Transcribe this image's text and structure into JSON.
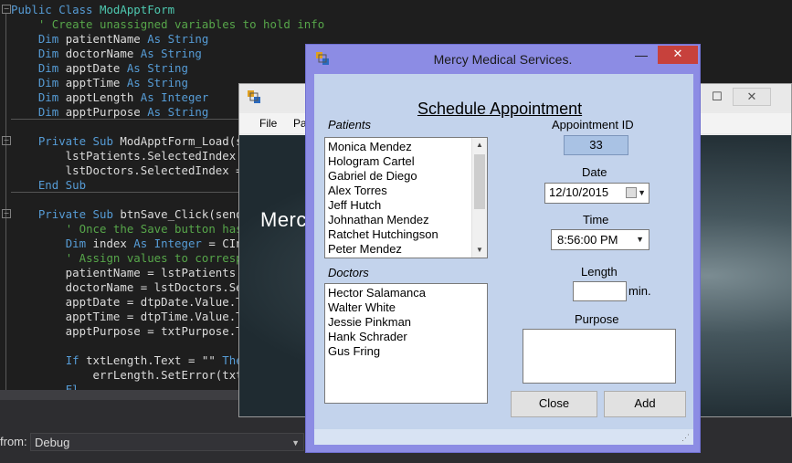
{
  "editor": {
    "lines": [
      {
        "segs": [
          [
            "kw",
            "Public Class "
          ],
          [
            "ty",
            "ModApptForm"
          ]
        ]
      },
      {
        "segs": [
          [
            "pl",
            "    "
          ],
          [
            "cm",
            "' Create unassigned variables to hold info"
          ]
        ]
      },
      {
        "segs": [
          [
            "pl",
            "    "
          ],
          [
            "kw",
            "Dim "
          ],
          [
            "pl",
            "patientName "
          ],
          [
            "kw",
            "As String"
          ]
        ]
      },
      {
        "segs": [
          [
            "pl",
            "    "
          ],
          [
            "kw",
            "Dim "
          ],
          [
            "pl",
            "doctorName "
          ],
          [
            "kw",
            "As String"
          ]
        ]
      },
      {
        "segs": [
          [
            "pl",
            "    "
          ],
          [
            "kw",
            "Dim "
          ],
          [
            "pl",
            "apptDate "
          ],
          [
            "kw",
            "As String"
          ]
        ]
      },
      {
        "segs": [
          [
            "pl",
            "    "
          ],
          [
            "kw",
            "Dim "
          ],
          [
            "pl",
            "apptTime "
          ],
          [
            "kw",
            "As String"
          ]
        ]
      },
      {
        "segs": [
          [
            "pl",
            "    "
          ],
          [
            "kw",
            "Dim "
          ],
          [
            "pl",
            "apptLength "
          ],
          [
            "kw",
            "As Integer"
          ]
        ]
      },
      {
        "segs": [
          [
            "pl",
            "    "
          ],
          [
            "kw",
            "Dim "
          ],
          [
            "pl",
            "apptPurpose "
          ],
          [
            "kw",
            "As String"
          ]
        ]
      },
      {
        "segs": []
      },
      {
        "segs": [
          [
            "pl",
            "    "
          ],
          [
            "kw",
            "Private Sub "
          ],
          [
            "pl",
            "ModApptForm_Load(sen"
          ]
        ]
      },
      {
        "segs": [
          [
            "pl",
            "        lstPatients.SelectedIndex = "
          ]
        ]
      },
      {
        "segs": [
          [
            "pl",
            "        lstDoctors.SelectedIndex = 0"
          ]
        ]
      },
      {
        "segs": [
          [
            "pl",
            "    "
          ],
          [
            "kw",
            "End Sub"
          ]
        ]
      },
      {
        "segs": []
      },
      {
        "segs": [
          [
            "pl",
            "    "
          ],
          [
            "kw",
            "Private Sub "
          ],
          [
            "pl",
            "btnSave_Click(sender"
          ]
        ]
      },
      {
        "segs": [
          [
            "pl",
            "        "
          ],
          [
            "cm",
            "' Once the Save button has b"
          ]
        ]
      },
      {
        "segs": [
          [
            "pl",
            "        "
          ],
          [
            "kw",
            "Dim "
          ],
          [
            "pl",
            "index "
          ],
          [
            "kw",
            "As Integer "
          ],
          [
            "pl",
            "= CInt"
          ]
        ]
      },
      {
        "segs": [
          [
            "pl",
            "        "
          ],
          [
            "cm",
            "' Assign values to correspon"
          ]
        ]
      },
      {
        "segs": [
          [
            "pl",
            "        patientName = lstPatients.Sel"
          ]
        ]
      },
      {
        "segs": [
          [
            "pl",
            "        doctorName = lstDoctors.Sele"
          ]
        ]
      },
      {
        "segs": [
          [
            "pl",
            "        apptDate = dtpDate.Value.ToS"
          ]
        ]
      },
      {
        "segs": [
          [
            "pl",
            "        apptTime = dtpTime.Value.ToS"
          ]
        ]
      },
      {
        "segs": [
          [
            "pl",
            "        apptPurpose = txtPurpose.Tex"
          ]
        ]
      },
      {
        "segs": []
      },
      {
        "segs": [
          [
            "pl",
            "        "
          ],
          [
            "kw",
            "If "
          ],
          [
            "pl",
            "txtLength.Text = "
          ],
          [
            "pl",
            "\"\" "
          ],
          [
            "kw",
            "Then"
          ]
        ]
      },
      {
        "segs": [
          [
            "pl",
            "            errLength.SetError(txtLe"
          ]
        ]
      },
      {
        "segs": [
          [
            "pl",
            "        "
          ],
          [
            "kw",
            "El"
          ]
        ]
      }
    ]
  },
  "bottom": {
    "from_label": "from:",
    "config_value": "Debug"
  },
  "main_form": {
    "menu": [
      "File",
      "Pa"
    ],
    "hero_title": "Merc"
  },
  "dialog": {
    "title": "Mercy Medical Services.",
    "close_glyph": "✕",
    "minimize_glyph": "—",
    "heading": "Schedule Appointment",
    "patients_label": "Patients",
    "patients": [
      "Monica Mendez",
      "Hologram Cartel",
      "Gabriel de Diego",
      "Alex Torres",
      "Jeff Hutch",
      "Johnathan Mendez",
      "Ratchet Hutchingson",
      "Peter Mendez"
    ],
    "doctors_label": "Doctors",
    "doctors": [
      "Hector Salamanca",
      "Walter White",
      "Jessie Pinkman",
      "Hank Schrader",
      "Gus Fring"
    ],
    "appt_id_label": "Appointment ID",
    "appt_id": "33",
    "date_label": "Date",
    "date_value": "12/10/2015",
    "time_label": "Time",
    "time_value": "8:56:00 PM",
    "length_label": "Length",
    "length_value": "",
    "length_unit": "min.",
    "purpose_label": "Purpose",
    "purpose_value": "",
    "close_button": "Close",
    "add_button": "Add"
  }
}
